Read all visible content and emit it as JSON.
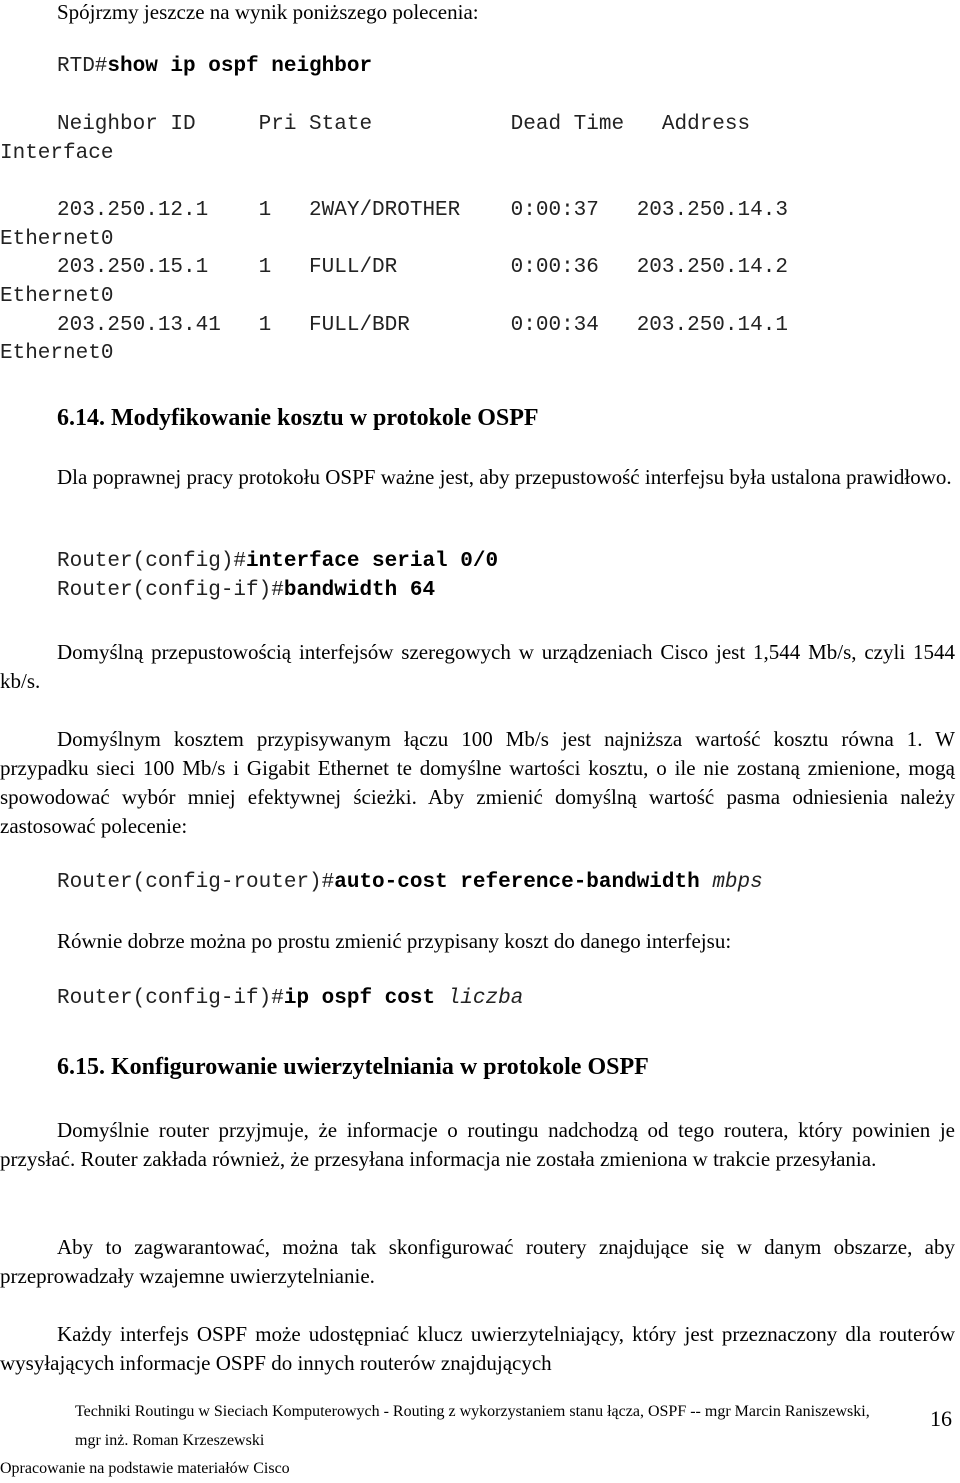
{
  "intro": "Spójrzmy jeszcze na wynik poniższego polecenia:",
  "cmd1": {
    "prompt": "RTD#",
    "command": "show ip ospf neighbor"
  },
  "table": {
    "header": "Neighbor ID     Pri State           Dead Time   Address",
    "header_wrap": "Interface",
    "rows": [
      {
        "line": "203.250.12.1    1   2WAY/DROTHER    0:00:37   203.250.14.3",
        "wrap": "Ethernet0"
      },
      {
        "line": "203.250.15.1    1   FULL/DR         0:00:36   203.250.14.2",
        "wrap": "Ethernet0"
      },
      {
        "line": "203.250.13.41   1   FULL/BDR        0:00:34   203.250.14.1",
        "wrap": "Ethernet0"
      }
    ]
  },
  "section1": {
    "title": "6.14. Modyfikowanie kosztu w protokole OSPF",
    "p1": "Dla poprawnej pracy protokołu OSPF ważne jest, aby przepustowość interfejsu była ustalona prawidłowo.",
    "cmd_a": {
      "prompt": "Router(config)#",
      "command": "interface serial 0/0"
    },
    "cmd_b": {
      "prompt": "Router(config-if)#",
      "command": "bandwidth 64"
    },
    "p2": "Domyślną przepustowością interfejsów szeregowych w urządzeniach Cisco jest 1,544 Mb/s, czyli 1544 kb/s.",
    "p3": "Domyślnym kosztem przypisywanym łączu 100 Mb/s jest najniższa wartość kosztu równa 1. W przypadku sieci 100 Mb/s i Gigabit Ethernet te domyślne wartości kosztu, o ile nie zostaną zmienione, mogą spowodować wybór mniej efektywnej ścieżki. Aby zmienić domyślną wartość pasma odniesienia należy zastosować polecenie:",
    "cmd_c": {
      "prompt": "Router(config-router)#",
      "command": "auto-cost reference-bandwidth",
      "arg": "mbps"
    },
    "p4": "Równie dobrze można po prostu zmienić przypisany koszt do danego interfejsu:",
    "cmd_d": {
      "prompt": "Router(config-if)#",
      "command": "ip ospf cost",
      "arg": "liczba"
    }
  },
  "section2": {
    "title": "6.15. Konfigurowanie uwierzytelniania w protokole OSPF",
    "p1": "Domyślnie router przyjmuje, że informacje o routingu nadchodzą od tego routera, który powinien je przysłać. Router zakłada również, że przesyłana informacja nie została zmieniona w trakcie przesyłania.",
    "p2": "Aby to zagwarantować, można tak skonfigurować routery znajdujące się w danym obszarze, aby przeprowadzały wzajemne uwierzytelnianie.",
    "p3": "Każdy interfejs OSPF może udostępniać klucz uwierzytelniający, który jest przeznaczony dla routerów wysyłających informacje OSPF do innych routerów znajdujących"
  },
  "footer": {
    "line1": "Techniki Routingu w Sieciach Komputerowych - Routing z wykorzystaniem stanu łącza, OSPF -- mgr Marcin Raniszewski,",
    "line2": "mgr inż. Roman Krzeszewski",
    "line3": "Opracowanie na podstawie materiałów Cisco",
    "page_number": "16"
  }
}
